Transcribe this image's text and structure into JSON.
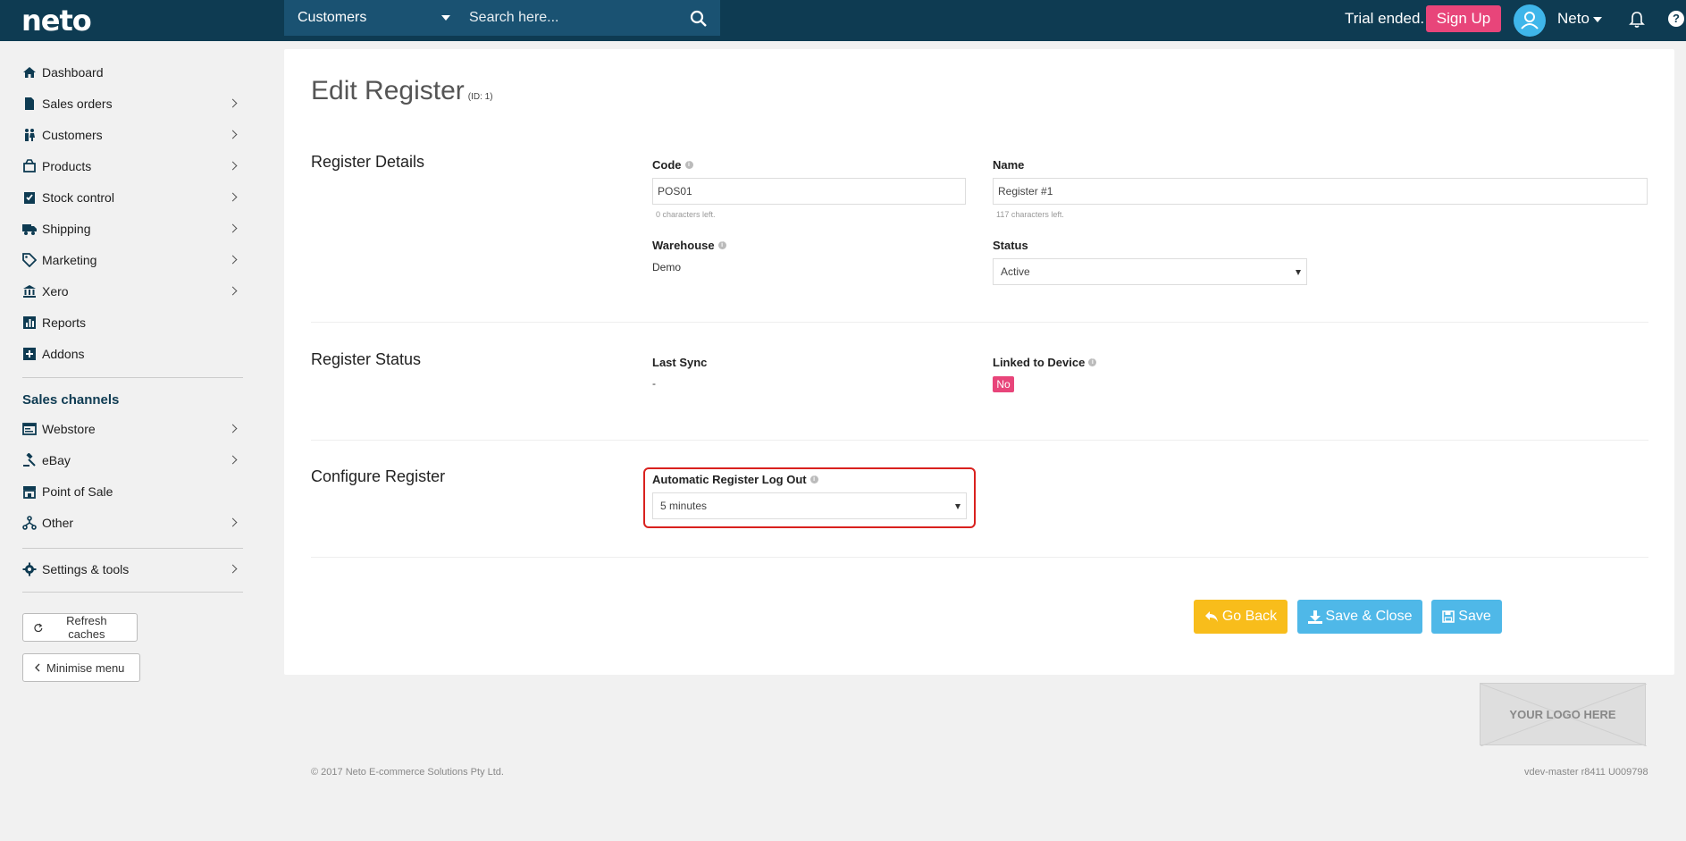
{
  "topbar": {
    "logo": "neto",
    "search_scope": "Customers",
    "search_placeholder": "Search here...",
    "trial_text": "Trial ended.",
    "signup_label": "Sign Up",
    "user_name": "Neto"
  },
  "sidebar": {
    "items": [
      {
        "label": "Dashboard",
        "icon": "home-icon"
      },
      {
        "label": "Sales orders",
        "icon": "document-icon"
      },
      {
        "label": "Customers",
        "icon": "people-icon"
      },
      {
        "label": "Products",
        "icon": "box-icon"
      },
      {
        "label": "Stock control",
        "icon": "clipboard-check-icon"
      },
      {
        "label": "Shipping",
        "icon": "truck-icon"
      },
      {
        "label": "Marketing",
        "icon": "tag-icon"
      },
      {
        "label": "Xero",
        "icon": "bank-icon"
      },
      {
        "label": "Reports",
        "icon": "bar-chart-icon"
      },
      {
        "label": "Addons",
        "icon": "plus-square-icon"
      }
    ],
    "sales_channels_heading": "Sales channels",
    "channels": [
      {
        "label": "Webstore",
        "icon": "window-icon"
      },
      {
        "label": "eBay",
        "icon": "gavel-icon"
      },
      {
        "label": "Point of Sale",
        "icon": "store-icon"
      },
      {
        "label": "Other",
        "icon": "network-icon"
      }
    ],
    "settings_label": "Settings & tools",
    "refresh_label": "Refresh caches",
    "minimise_label": "Minimise menu"
  },
  "page": {
    "title": "Edit Register",
    "id_label": "(ID: 1)"
  },
  "register_details": {
    "section_title": "Register Details",
    "code_label": "Code",
    "code_value": "POS01",
    "code_helper": "0 characters left.",
    "name_label": "Name",
    "name_value": "Register #1",
    "name_helper": "117 characters left.",
    "warehouse_label": "Warehouse",
    "warehouse_value": "Demo",
    "status_label": "Status",
    "status_value": "Active"
  },
  "register_status": {
    "section_title": "Register Status",
    "last_sync_label": "Last Sync",
    "last_sync_value": "-",
    "linked_label": "Linked to Device",
    "linked_value": "No"
  },
  "configure": {
    "section_title": "Configure Register",
    "logout_label": "Automatic Register Log Out",
    "logout_value": "5 minutes"
  },
  "actions": {
    "go_back": "Go Back",
    "save_close": "Save & Close",
    "save": "Save"
  },
  "footer": {
    "logo_placeholder": "YOUR LOGO HERE",
    "copyright": "© 2017 Neto E-commerce Solutions Pty Ltd.",
    "version": "vdev-master r8411 U009798"
  },
  "colors": {
    "topbar": "#0e3b52",
    "accent_pink": "#e8457a",
    "go_back": "#f8bd1b",
    "save_blue": "#4fb8e8",
    "highlight_red": "#d9211e"
  }
}
